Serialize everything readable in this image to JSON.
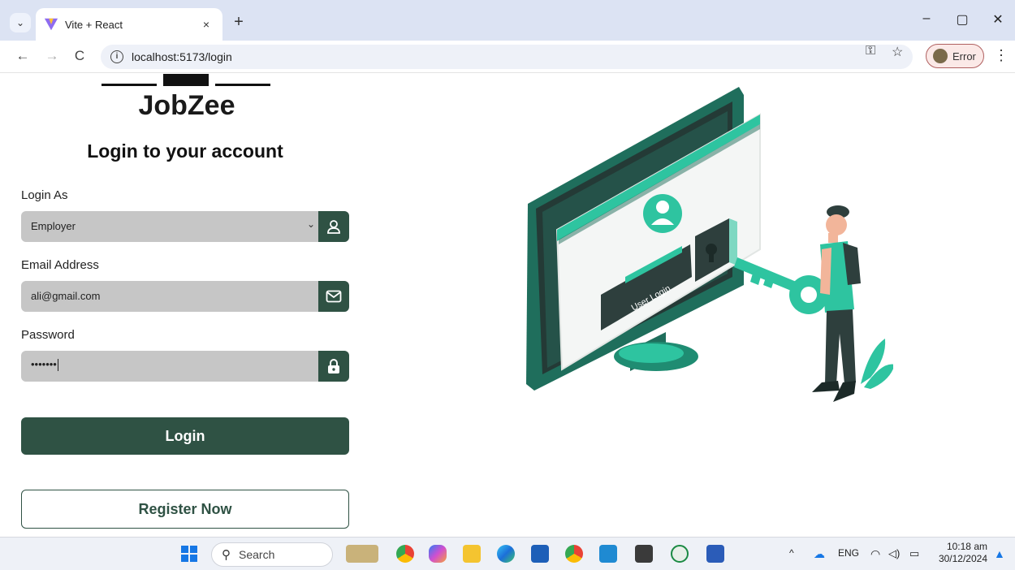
{
  "browser": {
    "tab_title": "Vite + React",
    "tab_close": "×",
    "new_tab": "+",
    "url": "localhost:5173/login",
    "profile_label": "Error",
    "win_minimize": "–",
    "win_restore": "▢",
    "win_close": "✕",
    "back": "←",
    "forward": "→",
    "reload": "C",
    "key_icon": "⚿",
    "star_icon": "☆",
    "menu": "⋮"
  },
  "login": {
    "brand": "JobZee",
    "heading": "Login to your account",
    "role_label": "Login As",
    "role_value": "Employer",
    "email_label": "Email Address",
    "email_value": "ali@gmail.com",
    "password_label": "Password",
    "password_value": "•••••••",
    "login_button": "Login",
    "register_button": "Register Now"
  },
  "illustration": {
    "screen_text": "User Login"
  },
  "taskbar": {
    "search_text": "Search",
    "language": "ENG",
    "time": "10:18 am",
    "date": "30/12/2024"
  },
  "colors": {
    "primary": "#2f5244",
    "accent_teal": "#2ec4a0",
    "field_bg": "#c6c6c6"
  }
}
